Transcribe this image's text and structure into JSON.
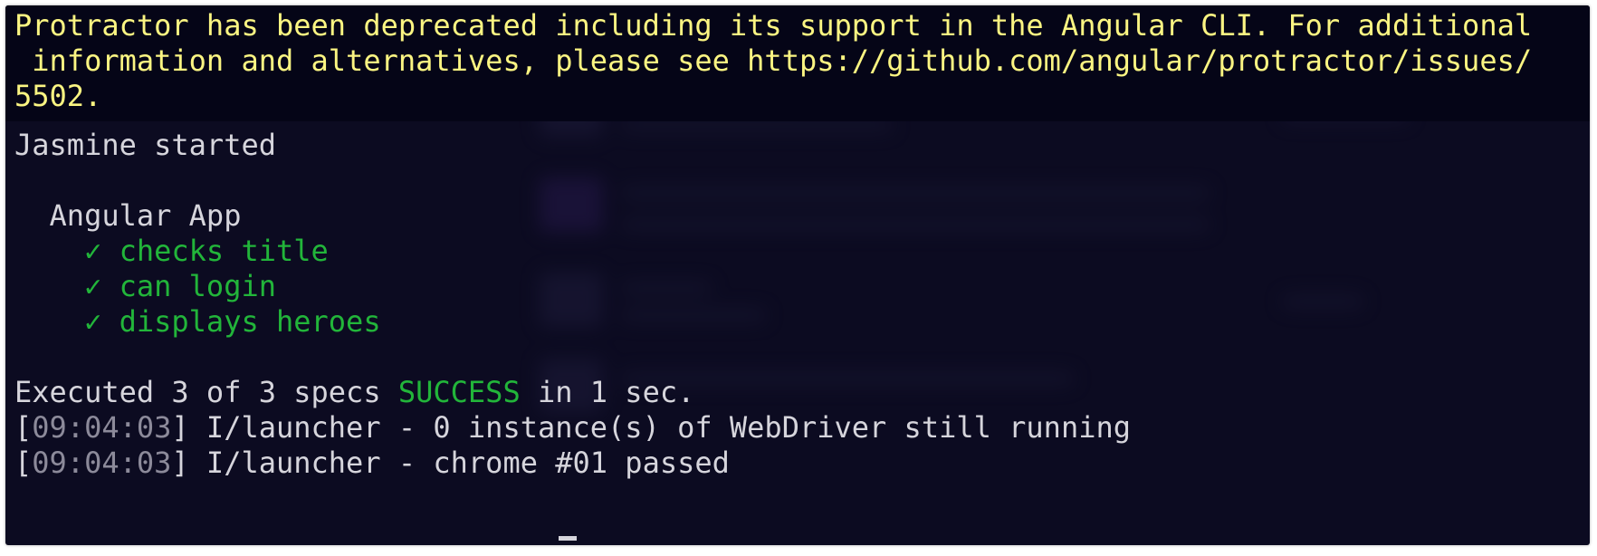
{
  "banner": {
    "line1": "Protractor has been deprecated including its support in the Angular CLI. For additional",
    "line2": " information and alternatives, please see https://github.com/angular/protractor/issues/",
    "line3": "5502."
  },
  "output": {
    "jasmine_started": "Jasmine started",
    "suite_name": "Angular App",
    "checkmark": "✓",
    "specs": [
      "checks title",
      "can login",
      "displays heroes"
    ],
    "summary_prefix": "Executed 3 of 3 specs ",
    "summary_status": "SUCCESS",
    "summary_suffix": " in 1 sec.",
    "log": [
      {
        "open": "[",
        "time": "09:04:03",
        "close": "]",
        "message": " I/launcher - 0 instance(s) of WebDriver still running"
      },
      {
        "open": "[",
        "time": "09:04:03",
        "close": "]",
        "message": " I/launcher - chrome #01 passed"
      }
    ]
  },
  "colors": {
    "background": "#0c0b21",
    "banner_text": "#fbf582",
    "success_green": "#22b53a",
    "text": "#d6d5dc",
    "timestamp": "#8c8a9a"
  }
}
